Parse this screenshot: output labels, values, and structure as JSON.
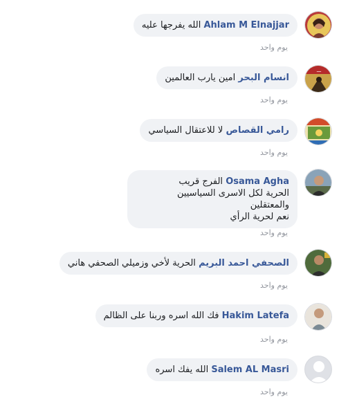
{
  "comments": [
    {
      "name": "Ahlam M Elnajjar",
      "text": "الله يفرجها عليه",
      "time": "يوم واحد"
    },
    {
      "name": "انسام البحر",
      "text": "امين يارب العالمين",
      "time": "يوم واحد"
    },
    {
      "name": "رامي القصاص",
      "text": "لا للاعتقال السياسي",
      "time": "يوم واحد"
    },
    {
      "name": "Osama Agha",
      "text_lines": [
        "الفرج قريب",
        "الحرية لكل الاسرى السياسيين والمعتقلين",
        "نعم لحرية الرأي"
      ],
      "time": "يوم واحد"
    },
    {
      "name": "الصحفي احمد البريم",
      "text": "الحرية لأخي وزميلي الصحفي هاني",
      "time": "يوم واحد"
    },
    {
      "name": "Hakim Latefa",
      "text": "فك الله اسره وربنا على الظالم",
      "time": "يوم واحد"
    },
    {
      "name": "Salem AL Masri",
      "text": "الله يفك اسره",
      "time": "يوم واحد"
    }
  ]
}
